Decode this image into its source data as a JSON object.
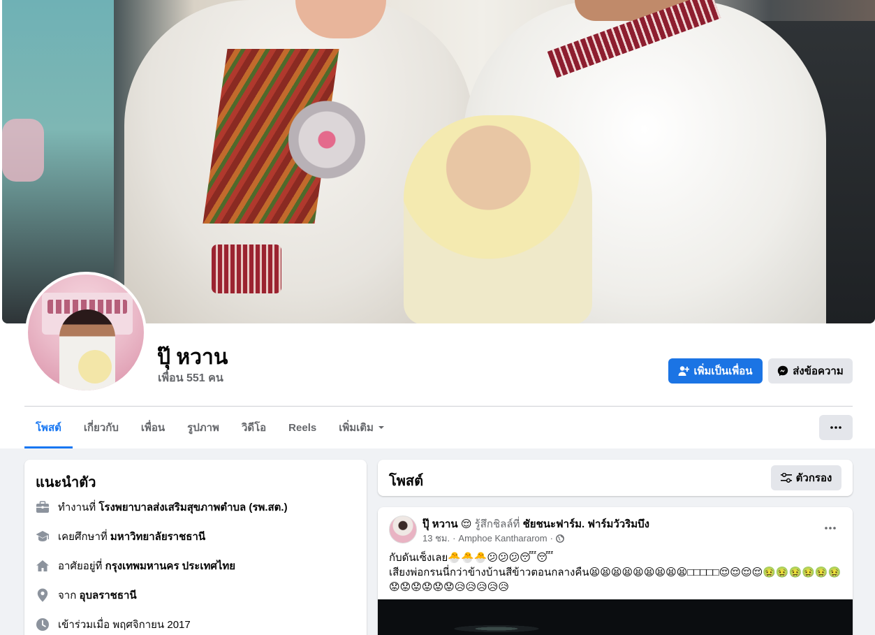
{
  "profile": {
    "name": "ปุ๊ หวาน",
    "friends_count": "เพื่อน 551 คน"
  },
  "actions": {
    "add_friend": "เพิ่มเป็นเพื่อน",
    "send_message": "ส่งข้อความ"
  },
  "tabs": [
    {
      "label": "โพสต์",
      "active": true
    },
    {
      "label": "เกี่ยวกับ"
    },
    {
      "label": "เพื่อน"
    },
    {
      "label": "รูปภาพ"
    },
    {
      "label": "วิดีโอ"
    },
    {
      "label": "Reels"
    },
    {
      "label": "เพิ่มเติม"
    }
  ],
  "intro": {
    "title": "แนะนำตัว",
    "rows": [
      {
        "icon": "briefcase-icon",
        "prefix": "ทำงานที่ ",
        "value": "โรงพยาบาลส่งเสริมสุขภาพตำบล (รพ.สต.)"
      },
      {
        "icon": "graduation-cap-icon",
        "prefix": "เคยศึกษาที่ ",
        "value": "มหาวิทยาลัยราชธานี"
      },
      {
        "icon": "home-icon",
        "prefix": "อาศัยอยู่ที่ ",
        "value": "กรุงเทพมหานคร ประเทศไทย"
      },
      {
        "icon": "location-pin-icon",
        "prefix": "จาก ",
        "value": "อุบลราชธานี"
      },
      {
        "icon": "clock-icon",
        "prefix": "เข้าร่วมเมื่อ พฤศจิกายน 2017",
        "value": ""
      }
    ]
  },
  "posts_section": {
    "title": "โพสต์",
    "filter_label": "ตัวกรอง"
  },
  "post": {
    "author": "ปุ๊ หวาน",
    "feeling_emoji": "😌",
    "feeling_text": "รู้สึกชิลล์ที่",
    "place": "ชัยชนะฟาร์ม. ฟาร์มวัวริมบึง",
    "time": "13 ชม.",
    "location": "Amphoe Kanthararom",
    "separator": "·",
    "text_line1": "กับดันเซ็งเลย🐣🐣🐣😕😕😕😴😴",
    "text_line2": "เสียงพ่อกรนนี่กว่าข้างบ้านสีข้าวตอนกลางคืน😫😫😫😫😫😫😫😫😫□□□□□😌😌😌😌🤢🤢🤢🤢🤢🤢",
    "text_line3": "😟😟😟😟😟😟😥😥😥😥😥"
  },
  "colors": {
    "primary": "#1b74e4",
    "tab_active": "#1877f2",
    "secondary_bg": "#e4e6eb",
    "page_bg": "#f0f2f5"
  }
}
